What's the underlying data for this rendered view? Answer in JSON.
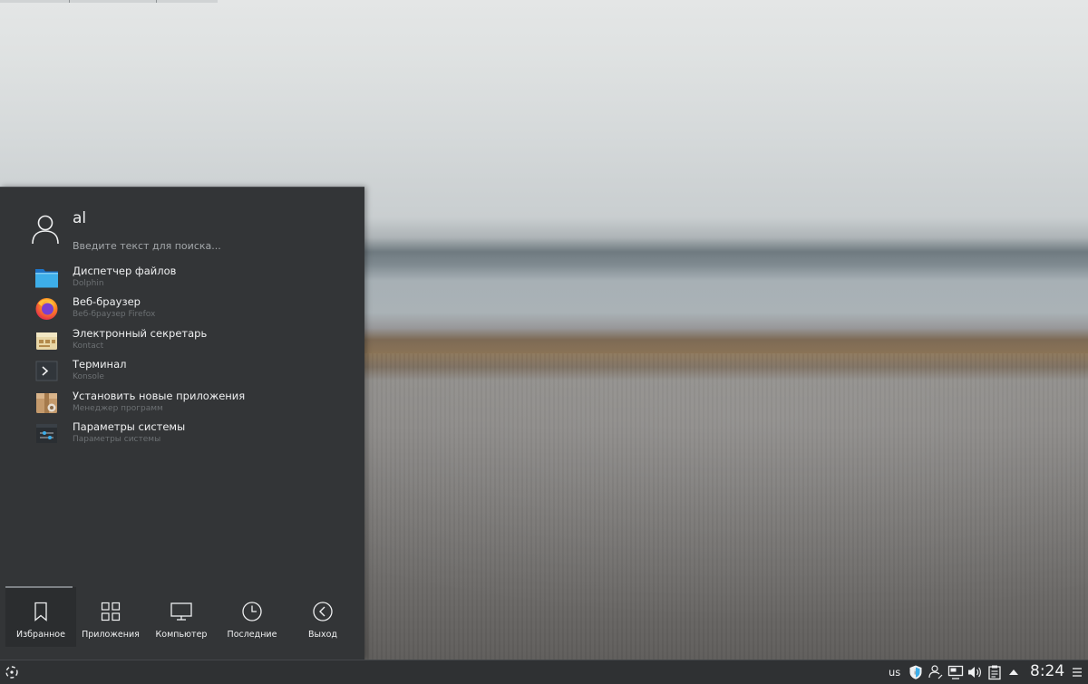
{
  "launcher": {
    "user_name": "al",
    "search_placeholder": "Введите текст для поиска...",
    "favorites": [
      {
        "name": "Диспетчер файлов",
        "description": "Dolphin",
        "icon": "folder-icon"
      },
      {
        "name": "Веб-браузер",
        "description": "Веб-браузер Firefox",
        "icon": "firefox-icon"
      },
      {
        "name": "Электронный секретарь",
        "description": "Kontact",
        "icon": "kontact-icon"
      },
      {
        "name": "Терминал",
        "description": "Konsole",
        "icon": "terminal-icon"
      },
      {
        "name": "Установить новые приложения",
        "description": "Менеджер программ",
        "icon": "package-icon"
      },
      {
        "name": "Параметры системы",
        "description": "Параметры системы",
        "icon": "settings-icon"
      }
    ],
    "tabs": [
      {
        "label": "Избранное",
        "icon": "bookmark-icon",
        "active": true
      },
      {
        "label": "Приложения",
        "icon": "grid-icon",
        "active": false
      },
      {
        "label": "Компьютер",
        "icon": "monitor-icon",
        "active": false
      },
      {
        "label": "Последние",
        "icon": "clock-icon",
        "active": false
      },
      {
        "label": "Выход",
        "icon": "chevron-left-icon",
        "active": false
      }
    ]
  },
  "taskbar": {
    "keyboard_layout": "us",
    "clock": "8:24",
    "tray_icons": [
      "shield-icon",
      "network-user-icon",
      "display-icon",
      "volume-icon",
      "clipboard-icon",
      "chevron-up-icon"
    ]
  },
  "colors": {
    "panel_bg": "#333537",
    "text": "#eff0f1",
    "subtext": "#6c7073",
    "accent_blue": "#3daee9"
  }
}
